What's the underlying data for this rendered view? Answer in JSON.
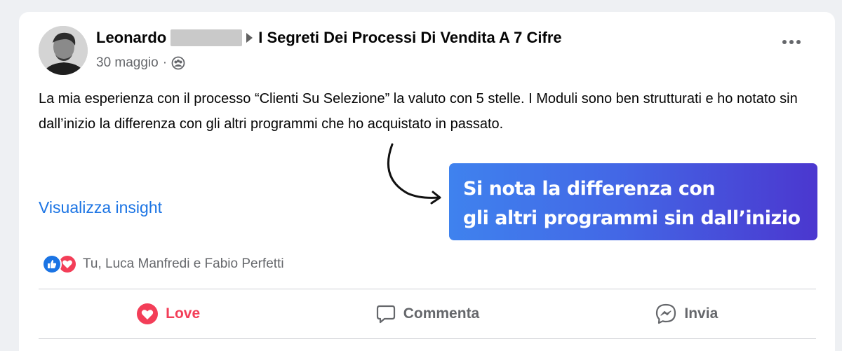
{
  "post": {
    "author": "Leonardo",
    "group": "I Segreti Dei Processi Di Vendita A 7 Cifre",
    "date": "30 maggio",
    "separator": "·",
    "text": "La mia esperienza con il processo “Clienti Su Selezione” la valuto con 5 stelle. I Moduli sono ben strutturati e ho notato sin dall’inizio la differenza con gli altri programmi che ho acquistato in passato.",
    "insight_link": "Visualizza insight"
  },
  "callout": {
    "line1": "Si nota la differenza con",
    "line2": "gli altri programmi sin dall’inizio"
  },
  "reactions": {
    "icons": [
      "like-icon",
      "love-icon"
    ],
    "names": "Tu, Luca Manfredi e Fabio Perfetti"
  },
  "actions": {
    "love": "Love",
    "comment": "Commenta",
    "share": "Invia"
  },
  "colors": {
    "accent_blue": "#1b74e4",
    "love_red": "#f33e58",
    "callout_start": "#3f82ee",
    "callout_end": "#4b37cf"
  }
}
